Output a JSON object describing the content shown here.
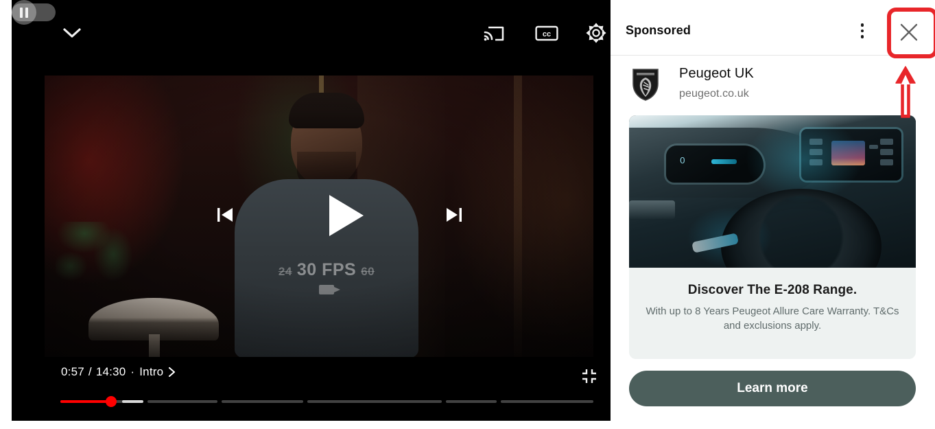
{
  "player": {
    "collapse_icon": "chevron-down-icon",
    "autoplay_toggle": {
      "icon": "pause-icon",
      "state": "paused"
    },
    "cast_icon": "cast-icon",
    "captions_icon": "closed-captions-icon",
    "settings_icon": "gear-icon",
    "previous_icon": "skip-previous-icon",
    "play_icon": "play-icon",
    "next_icon": "skip-next-icon",
    "fullscreen_icon": "exit-fullscreen-icon",
    "current_time": "0:57",
    "separator": "/",
    "duration": "14:30",
    "chapter_dot": "·",
    "chapter_name": "Intro",
    "chapter_arrow_icon": "chevron-right-icon",
    "progress": {
      "played_fraction": 0.101,
      "buffered_fraction": 0.157,
      "chapters": [
        {
          "start": 0.0,
          "end": 0.155
        },
        {
          "start": 0.163,
          "end": 0.295
        },
        {
          "start": 0.303,
          "end": 0.455
        },
        {
          "start": 0.463,
          "end": 0.715
        },
        {
          "start": 0.723,
          "end": 0.818
        },
        {
          "start": 0.826,
          "end": 1.0
        }
      ]
    },
    "video_still": {
      "shirt_text_main": "30 FPS",
      "shirt_text_left": "24",
      "shirt_text_right": "60"
    }
  },
  "ad": {
    "header_label": "Sponsored",
    "menu_icon": "kebab-menu-icon",
    "close_icon": "close-icon",
    "advertiser_name": "Peugeot UK",
    "advertiser_url": "peugeot.co.uk",
    "advertiser_logo_icon": "peugeot-shield-logo-icon",
    "headline": "Discover The E-208 Range.",
    "description": "With up to 8 Years Peugeot Allure Care Warranty. T&Cs and exclusions apply.",
    "cta_label": "Learn more",
    "colors": {
      "cta_background": "#4c5f5c",
      "card_background": "#eef2f1",
      "panel_background": "#ffffff",
      "headline_text": "#1b1b1b",
      "description_text": "#5f6b6b",
      "url_text": "#6e6e6e"
    }
  },
  "annotation": {
    "highlight_target": "close-icon",
    "shape": "rounded-rectangle-outline-with-up-arrow",
    "color": "#e8262a"
  }
}
